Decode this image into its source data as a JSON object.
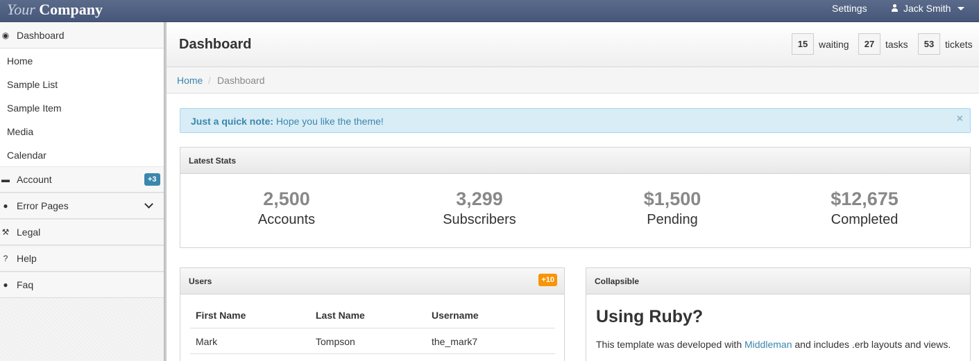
{
  "navbar": {
    "brand_your": "Your",
    "brand_company": "Company",
    "settings_label": "Settings",
    "user_name": "Jack Smith"
  },
  "sidebar": {
    "dashboard": "Dashboard",
    "sub_items": [
      "Home",
      "Sample List",
      "Sample Item",
      "Media",
      "Calendar"
    ],
    "account": "Account",
    "account_badge": "+3",
    "error_pages": "Error Pages",
    "legal": "Legal",
    "help": "Help",
    "faq": "Faq"
  },
  "header": {
    "title": "Dashboard",
    "stats": [
      {
        "value": "15",
        "label": "waiting"
      },
      {
        "value": "27",
        "label": "tasks"
      },
      {
        "value": "53",
        "label": "tickets"
      }
    ]
  },
  "breadcrumb": {
    "home": "Home",
    "separator": "/",
    "current": "Dashboard"
  },
  "alert": {
    "strong": "Just a quick note:",
    "text": " Hope you like the theme!",
    "close": "×"
  },
  "latest_stats": {
    "title": "Latest Stats",
    "items": [
      {
        "value": "2,500",
        "label": "Accounts"
      },
      {
        "value": "3,299",
        "label": "Subscribers"
      },
      {
        "value": "$1,500",
        "label": "Pending"
      },
      {
        "value": "$12,675",
        "label": "Completed"
      }
    ]
  },
  "users": {
    "title": "Users",
    "badge": "+10",
    "columns": [
      "First Name",
      "Last Name",
      "Username"
    ],
    "rows": [
      [
        "Mark",
        "Tompson",
        "the_mark7"
      ]
    ]
  },
  "collapsible": {
    "title": "Collapsible",
    "heading": "Using Ruby?",
    "text_before": "This template was developed with ",
    "link": "Middleman",
    "text_after": " and includes .erb layouts and views."
  },
  "colors": {
    "navbar": "#4e5f80",
    "link": "#3a87ad",
    "badge_blue": "#3a87ad",
    "badge_orange": "#f89406",
    "alert_bg": "#d9edf7"
  }
}
